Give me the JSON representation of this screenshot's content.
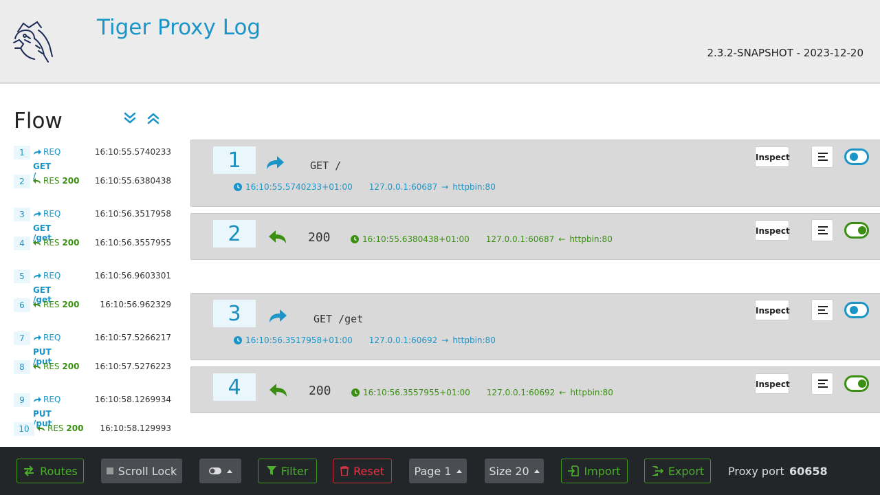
{
  "header": {
    "title": "Tiger Proxy Log",
    "version": "2.3.2-SNAPSHOT - 2023-12-20"
  },
  "sidebar": {
    "title": "Flow",
    "items": [
      {
        "num": "1",
        "kind": "REQ",
        "time": "16:10:55.5740233",
        "path": "GET /"
      },
      {
        "num": "2",
        "kind": "RES",
        "code": "200",
        "time": "16:10:55.6380438"
      },
      {
        "num": "3",
        "kind": "REQ",
        "time": "16:10:56.3517958",
        "path": "GET /get"
      },
      {
        "num": "4",
        "kind": "RES",
        "code": "200",
        "time": "16:10:56.3557955"
      },
      {
        "num": "5",
        "kind": "REQ",
        "time": "16:10:56.9603301",
        "path": "GET /get"
      },
      {
        "num": "6",
        "kind": "RES",
        "code": "200",
        "time": "16:10:56.962329"
      },
      {
        "num": "7",
        "kind": "REQ",
        "time": "16:10:57.5266217",
        "path": "PUT /put"
      },
      {
        "num": "8",
        "kind": "RES",
        "code": "200",
        "time": "16:10:57.5276223"
      },
      {
        "num": "9",
        "kind": "REQ",
        "time": "16:10:58.1269934",
        "path": "PUT /put"
      },
      {
        "num": "10",
        "kind": "RES",
        "code": "200",
        "time": "16:10:58.129993"
      }
    ]
  },
  "messages": [
    {
      "num": "1",
      "type": "req",
      "method": "GET /",
      "timestamp": "16:10:55.5740233+01:00",
      "from": "127.0.0.1:60687",
      "to": "httpbin:80",
      "inspect": "Inspect"
    },
    {
      "num": "2",
      "type": "res",
      "status": "200",
      "timestamp": "16:10:55.6380438+01:00",
      "from": "127.0.0.1:60687",
      "to": "httpbin:80",
      "inspect": "Inspect"
    },
    {
      "num": "3",
      "type": "req",
      "method": "GET /get",
      "timestamp": "16:10:56.3517958+01:00",
      "from": "127.0.0.1:60692",
      "to": "httpbin:80",
      "inspect": "Inspect"
    },
    {
      "num": "4",
      "type": "res",
      "status": "200",
      "timestamp": "16:10:56.3557955+01:00",
      "from": "127.0.0.1:60692",
      "to": "httpbin:80",
      "inspect": "Inspect"
    }
  ],
  "footer": {
    "routes": "Routes",
    "scroll_lock": "Scroll Lock",
    "filter": "Filter",
    "reset": "Reset",
    "page": "Page 1",
    "size": "Size 20",
    "import": "Import",
    "export": "Export",
    "proxy_label": "Proxy port",
    "proxy_port": "60658"
  },
  "colors": {
    "accent_blue": "#1b95c8",
    "accent_green": "#3a8f12",
    "danger": "#e53347"
  }
}
